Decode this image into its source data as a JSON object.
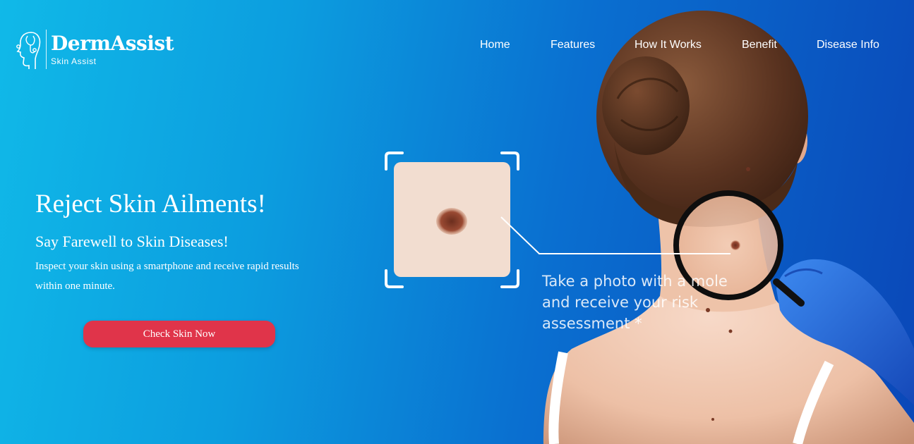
{
  "header": {
    "brand_name": "DermAssist",
    "brand_tagline": "Skin Assist",
    "logo_icon": "head-stethoscope-icon",
    "nav": [
      {
        "label": "Home"
      },
      {
        "label": "Features"
      },
      {
        "label": "How It Works"
      },
      {
        "label": "Benefit"
      },
      {
        "label": "Disease Info"
      }
    ]
  },
  "hero": {
    "title": "Reject Skin Ailments!",
    "subtitle": "Say Farewell to Skin Diseases!",
    "description": "Inspect your skin using a smartphone and receive rapid results within one minute.",
    "cta_label": "Check Skin Now"
  },
  "illustration": {
    "caption": "Take a photo with a mole and receive your risk assessment *",
    "icons": [
      "scan-frame-icon",
      "magnifying-glass-icon"
    ]
  },
  "colors": {
    "gradient_start": "#10b9e8",
    "gradient_end": "#0a47b8",
    "cta_background": "#e0344a",
    "text": "#ffffff"
  }
}
